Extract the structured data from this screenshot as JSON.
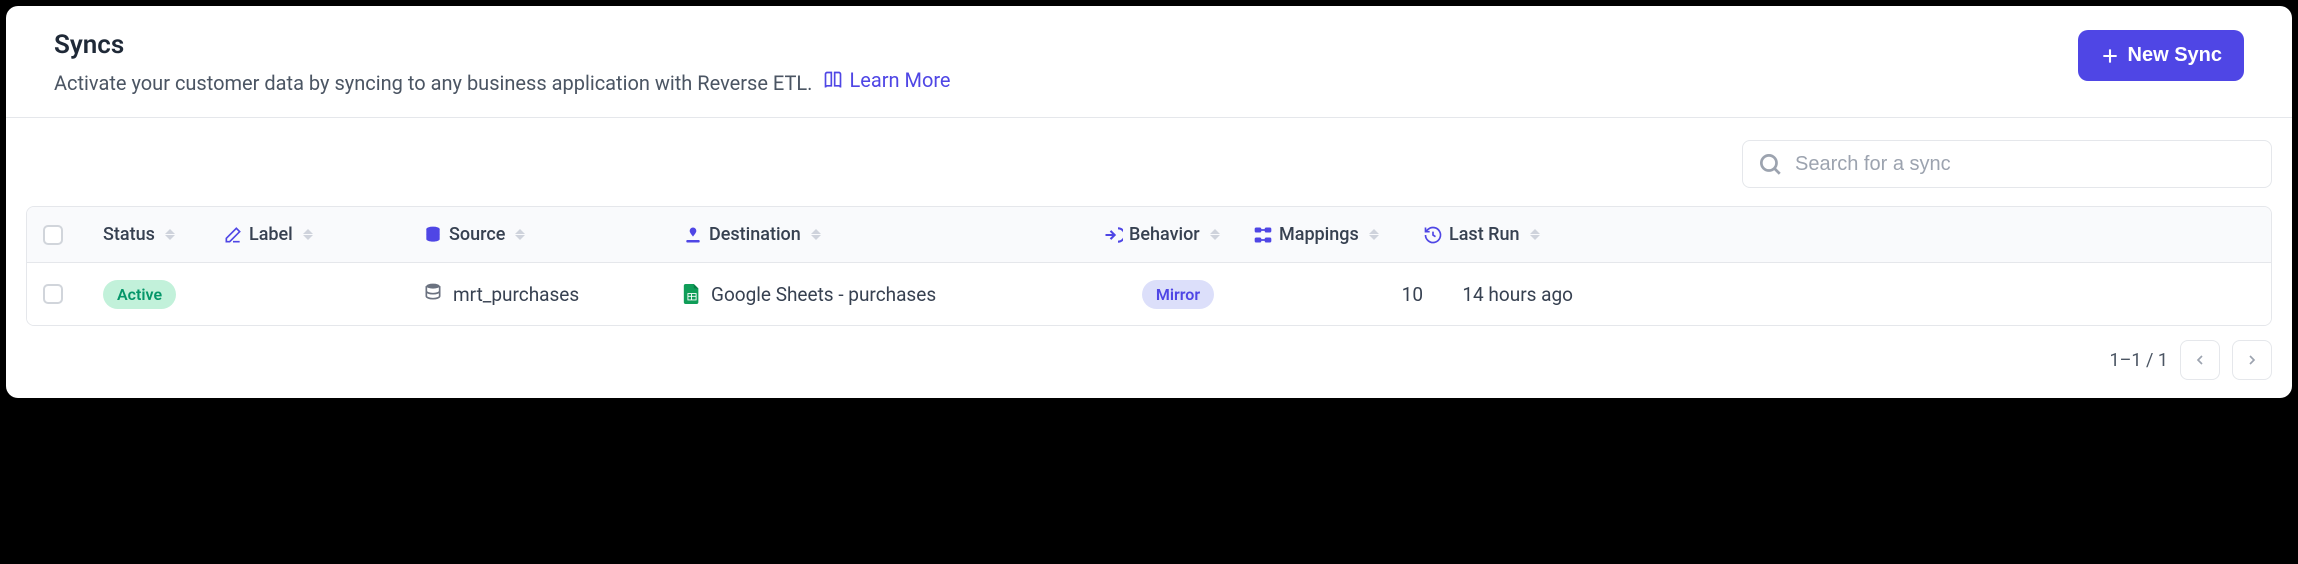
{
  "header": {
    "title": "Syncs",
    "subtitle": "Activate your customer data by syncing to any business application with Reverse ETL.",
    "learn_more": "Learn More",
    "new_sync": "New Sync"
  },
  "search": {
    "placeholder": "Search for a sync"
  },
  "columns": {
    "status": "Status",
    "label": "Label",
    "source": "Source",
    "destination": "Destination",
    "behavior": "Behavior",
    "mappings": "Mappings",
    "last_run": "Last Run"
  },
  "rows": [
    {
      "status": "Active",
      "label": "",
      "source": "mrt_purchases",
      "destination": "Google Sheets - purchases",
      "behavior": "Mirror",
      "mappings": "10",
      "last_run": "14 hours ago"
    }
  ],
  "pagination": {
    "range": "1–1 / 1"
  }
}
